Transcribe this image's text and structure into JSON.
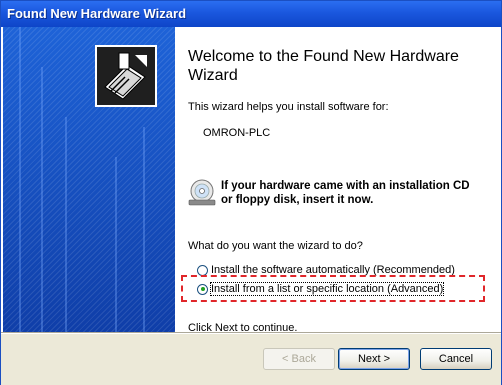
{
  "window": {
    "title": "Found New Hardware Wizard"
  },
  "main": {
    "heading": "Welcome to the Found New Hardware Wizard",
    "intro": "This wizard helps you install software for:",
    "device": "OMRON-PLC",
    "cd_notice_line1": "If your hardware came with an installation CD",
    "cd_notice_line2": "or floppy disk, insert it now.",
    "question": "What do you want the wizard to do?",
    "options": [
      {
        "label": "Install the software automatically (Recommended)",
        "selected": false
      },
      {
        "label": "Install from a list or specific location (Advanced)",
        "selected": true
      }
    ],
    "footer_hint": "Click Next to continue."
  },
  "buttons": {
    "back": "< Back",
    "next": "Next >",
    "cancel": "Cancel"
  },
  "colors": {
    "titlebar": "#1a57de",
    "highlight": "#e0262a",
    "side_panel": "#1a4fc4"
  },
  "icons": {
    "hardware": "hardware-card-icon",
    "cd": "cd-disc-icon"
  }
}
